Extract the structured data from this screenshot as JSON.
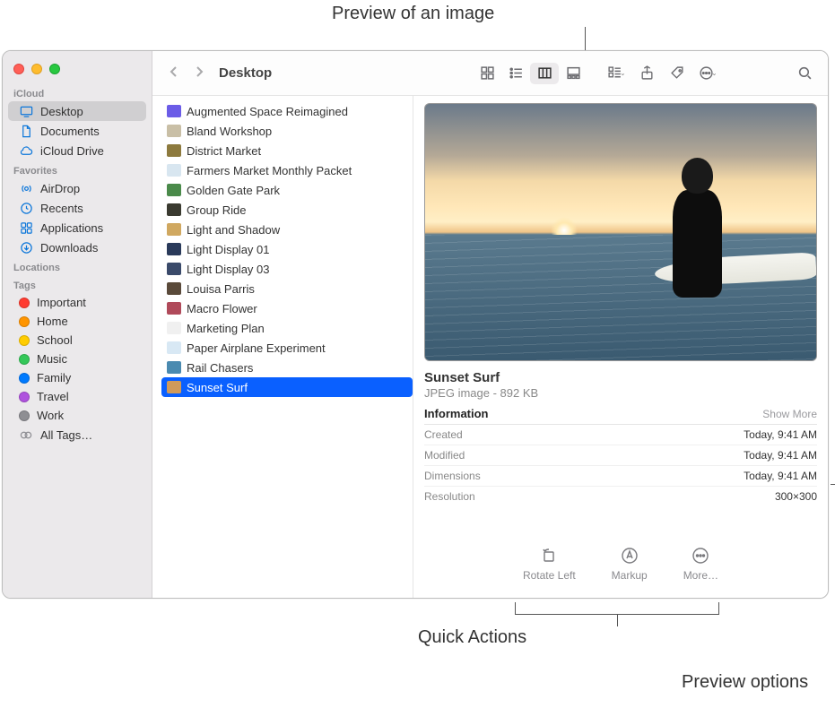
{
  "annotations": {
    "preview_image": "Preview of an image",
    "quick_actions": "Quick Actions",
    "preview_options": "Preview options"
  },
  "window": {
    "location_title": "Desktop"
  },
  "sidebar": {
    "sections": {
      "icloud": "iCloud",
      "favorites": "Favorites",
      "locations": "Locations",
      "tags": "Tags"
    },
    "icloud_items": [
      {
        "label": "Desktop",
        "icon": "desktop",
        "active": true
      },
      {
        "label": "Documents",
        "icon": "doc"
      },
      {
        "label": "iCloud Drive",
        "icon": "cloud"
      }
    ],
    "favorites": [
      {
        "label": "AirDrop",
        "icon": "airdrop"
      },
      {
        "label": "Recents",
        "icon": "clock"
      },
      {
        "label": "Applications",
        "icon": "apps"
      },
      {
        "label": "Downloads",
        "icon": "download"
      }
    ],
    "tags": [
      {
        "label": "Important",
        "color": "#ff3b30"
      },
      {
        "label": "Home",
        "color": "#ff9500"
      },
      {
        "label": "School",
        "color": "#ffcc00"
      },
      {
        "label": "Music",
        "color": "#34c759"
      },
      {
        "label": "Family",
        "color": "#007aff"
      },
      {
        "label": "Travel",
        "color": "#af52de"
      },
      {
        "label": "Work",
        "color": "#8e8e93"
      },
      {
        "label": "All Tags…",
        "color": null
      }
    ]
  },
  "files": [
    {
      "label": "Augmented Space Reimagined",
      "thumb": "#6b5ce7"
    },
    {
      "label": "Bland Workshop",
      "thumb": "#c9bfa6"
    },
    {
      "label": "District Market",
      "thumb": "#8d7a3e"
    },
    {
      "label": "Farmers Market Monthly Packet",
      "thumb": "#d8e6f0"
    },
    {
      "label": "Golden Gate Park",
      "thumb": "#4a8a4a"
    },
    {
      "label": "Group Ride",
      "thumb": "#3a3a30"
    },
    {
      "label": "Light and Shadow",
      "thumb": "#d0a860"
    },
    {
      "label": "Light Display 01",
      "thumb": "#2a3a5a"
    },
    {
      "label": "Light Display 03",
      "thumb": "#3a4a6a"
    },
    {
      "label": "Louisa Parris",
      "thumb": "#5a4a3a"
    },
    {
      "label": "Macro Flower",
      "thumb": "#b04a5a"
    },
    {
      "label": "Marketing Plan",
      "thumb": "#f0f0f0"
    },
    {
      "label": "Paper Airplane Experiment",
      "thumb": "#d8e8f4"
    },
    {
      "label": "Rail Chasers",
      "thumb": "#4a8ab0"
    },
    {
      "label": "Sunset Surf",
      "thumb": "#d09a5a",
      "selected": true
    }
  ],
  "preview": {
    "title": "Sunset Surf",
    "subtitle": "JPEG image - 892 KB",
    "info_heading": "Information",
    "show_more": "Show More",
    "rows": [
      {
        "k": "Created",
        "v": "Today, 9:41 AM"
      },
      {
        "k": "Modified",
        "v": "Today, 9:41 AM"
      },
      {
        "k": "Dimensions",
        "v": "Today, 9:41 AM"
      },
      {
        "k": "Resolution",
        "v": "300×300"
      }
    ],
    "quick_actions": [
      {
        "label": "Rotate Left",
        "icon": "rotate"
      },
      {
        "label": "Markup",
        "icon": "markup"
      },
      {
        "label": "More…",
        "icon": "more"
      }
    ]
  }
}
